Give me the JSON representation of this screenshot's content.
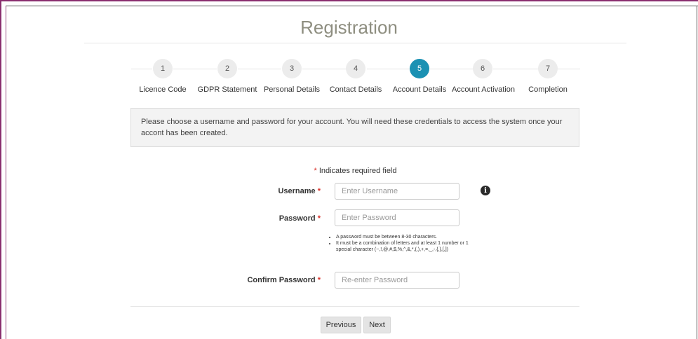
{
  "page": {
    "title": "Registration"
  },
  "steps": [
    {
      "number": "1",
      "label": "Licence Code",
      "active": false
    },
    {
      "number": "2",
      "label": "GDPR Statement",
      "active": false
    },
    {
      "number": "3",
      "label": "Personal Details",
      "active": false
    },
    {
      "number": "4",
      "label": "Contact Details",
      "active": false
    },
    {
      "number": "5",
      "label": "Account Details",
      "active": true
    },
    {
      "number": "6",
      "label": "Account Activation",
      "active": false
    },
    {
      "number": "7",
      "label": "Completion",
      "active": false
    }
  ],
  "info": {
    "text": "Please choose a username and password for your account. You will need these credentials to access the system once your accont has been created."
  },
  "form": {
    "required_star": "*",
    "required_note": " Indicates required field",
    "username": {
      "label": "Username",
      "placeholder": "Enter Username",
      "value": ""
    },
    "password": {
      "label": "Password",
      "placeholder": "Enter Password",
      "value": ""
    },
    "confirm_password": {
      "label": "Confirm Password",
      "placeholder": "Re-enter Password",
      "value": ""
    },
    "password_rules": [
      "A password must be between 8-30 characters.",
      "It must be a combination of letters and at least 1 number or 1 special character (~,!,@,#,$,%,^,&,*,(,),+,=,_,-,{,},[,])"
    ],
    "info_icon": "info-icon"
  },
  "buttons": {
    "previous": "Previous",
    "next": "Next"
  },
  "colors": {
    "active_step": "#1b91b3",
    "required": "#d9302a",
    "frame_accent": "#8a2f6f"
  }
}
